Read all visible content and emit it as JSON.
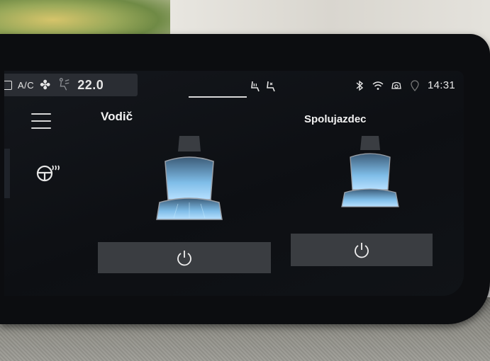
{
  "status_bar": {
    "ac_label": "A/C",
    "temperature": "22.0",
    "time": "14:31",
    "icons": [
      "recirculation-icon",
      "fan-icon",
      "airflow-icon",
      "seat-heat-tab-icon",
      "seat-vent-tab-icon",
      "bluetooth-icon",
      "wifi-icon",
      "4g-icon",
      "location-icon"
    ]
  },
  "sidebar": {
    "icons": [
      "menu-icon",
      "steering-wheel-heat-icon"
    ]
  },
  "seats": {
    "driver": {
      "title": "Vodič"
    },
    "passenger": {
      "title": "Spolujazdec"
    }
  },
  "colors": {
    "screen_bg": "#0d0f13",
    "button_bg": "#3a3d41",
    "seat_glow": "#8fd0ff"
  }
}
